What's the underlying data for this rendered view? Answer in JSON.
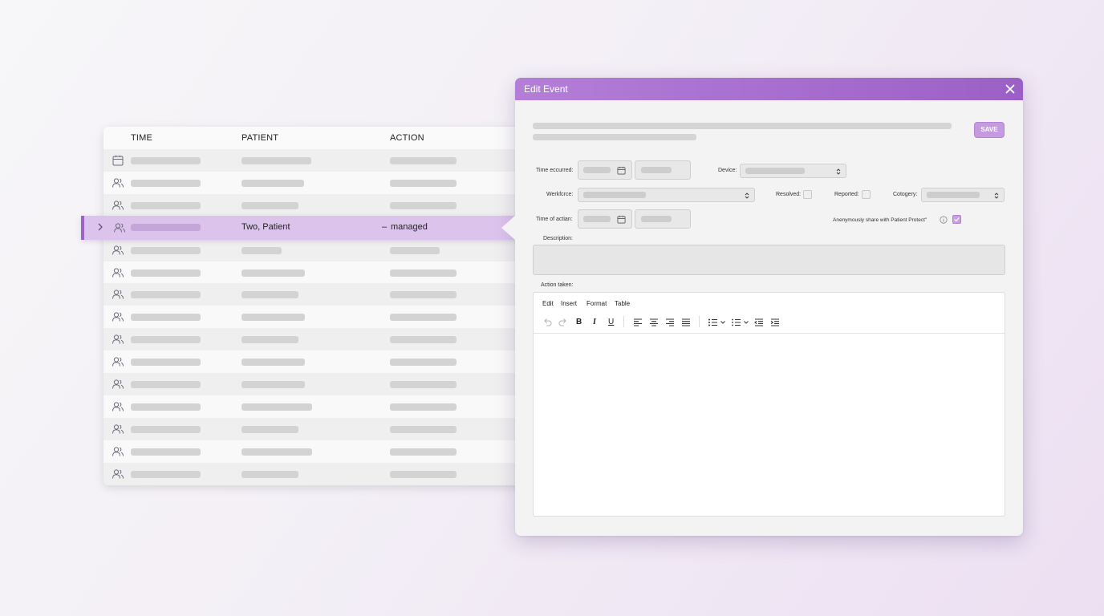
{
  "table": {
    "headers": {
      "time": "TIME",
      "patient": "PATIENT",
      "action": "ACTION"
    },
    "selected": {
      "patient": "Two, Patient",
      "action_prefix": "–",
      "action": "managed"
    }
  },
  "dialog": {
    "title": "Edit Event",
    "save_label": "SAVE",
    "labels": {
      "time_occurred": "Time eccurred:",
      "device": "Device:",
      "workforce": "Werkfcrce:",
      "resolved": "Resolved:",
      "reported": "Reported:",
      "category": "Cotogery:",
      "time_of_action": "Time of actian:",
      "share": "Anenymously share with Patient Protect\"",
      "description": "Description:",
      "action_taken": "Action taken:"
    },
    "checkboxes": {
      "resolved": false,
      "reported": false,
      "share": true
    },
    "editor_menu": [
      "Edit",
      "Insert",
      "Format",
      "Table"
    ]
  },
  "icons": {
    "close": "close-icon",
    "calendar": "calendar-icon",
    "people": "people-icon",
    "chevron": "chevron-right-icon",
    "info": "info-icon"
  },
  "colors": {
    "accent": "#a66bcf",
    "selected_row": "#dcc3ec",
    "header": "#b47ed8"
  }
}
